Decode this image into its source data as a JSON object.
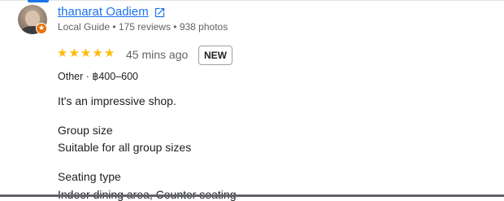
{
  "reviewer": {
    "name": "thanarat Oadiem",
    "meta": "Local Guide • 175 reviews • 938 photos",
    "avatar_icon": "user-avatar",
    "badge_icon": "local-guide-star-icon",
    "link_icon": "open-external-icon"
  },
  "review": {
    "rating": 5,
    "rating_max": 5,
    "time": "45 mins ago",
    "badge": "NEW",
    "meal_info": "Other · ฿400–600",
    "text": "It's an impressive shop."
  },
  "attributes": [
    {
      "title": "Group size",
      "value": "Suitable for all group sizes"
    },
    {
      "title": "Seating type",
      "value": "Indoor dining area, Counter seating"
    }
  ],
  "colors": {
    "link": "#1a73e8",
    "star": "#fbbc04",
    "muted_text": "#5f6368",
    "guide_badge": "#e8710a"
  }
}
